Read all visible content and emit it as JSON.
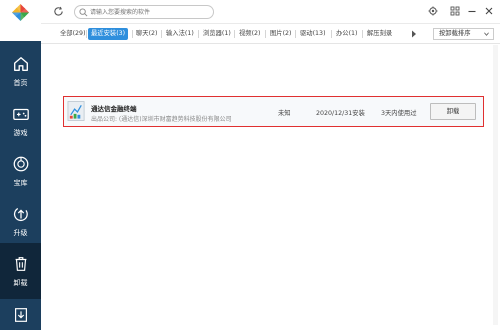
{
  "sidebar": {
    "items": [
      {
        "label": "首页",
        "icon": "home-icon",
        "active": false
      },
      {
        "label": "游戏",
        "icon": "gamepad-icon",
        "active": false
      },
      {
        "label": "宝库",
        "icon": "vault-icon",
        "active": false
      },
      {
        "label": "升级",
        "icon": "upgrade-icon",
        "active": false
      },
      {
        "label": "卸载",
        "icon": "trash-icon",
        "active": true
      },
      {
        "label": "",
        "icon": "download-icon",
        "active": false
      }
    ]
  },
  "header": {
    "search_placeholder": "请输入您要搜索的软件"
  },
  "tabs": [
    {
      "label": "全部(29)",
      "active": false
    },
    {
      "label": "最近安装(3)",
      "active": true
    },
    {
      "label": "聊天(2)",
      "active": false
    },
    {
      "label": "输入法(1)",
      "active": false
    },
    {
      "label": "浏览器(1)",
      "active": false
    },
    {
      "label": "视频(2)",
      "active": false
    },
    {
      "label": "图片(2)",
      "active": false
    },
    {
      "label": "驱动(13)",
      "active": false
    },
    {
      "label": "办公(1)",
      "active": false
    },
    {
      "label": "解压刻录",
      "active": false
    }
  ],
  "sort": {
    "label": "按卸载排序"
  },
  "apps": [
    {
      "name": "通达信金融终端",
      "publisher": "出品公司: (通达信)深圳市财富趋势科技股份有限公司",
      "size": "未知",
      "installed": "2020/12/31安装",
      "usage": "3天内使用过",
      "action": "卸载"
    }
  ],
  "colors": {
    "sidebar": "#1c3f5e",
    "sidebar_active": "#10263a",
    "accent": "#2f8fdd",
    "highlight_border": "#e03030"
  }
}
